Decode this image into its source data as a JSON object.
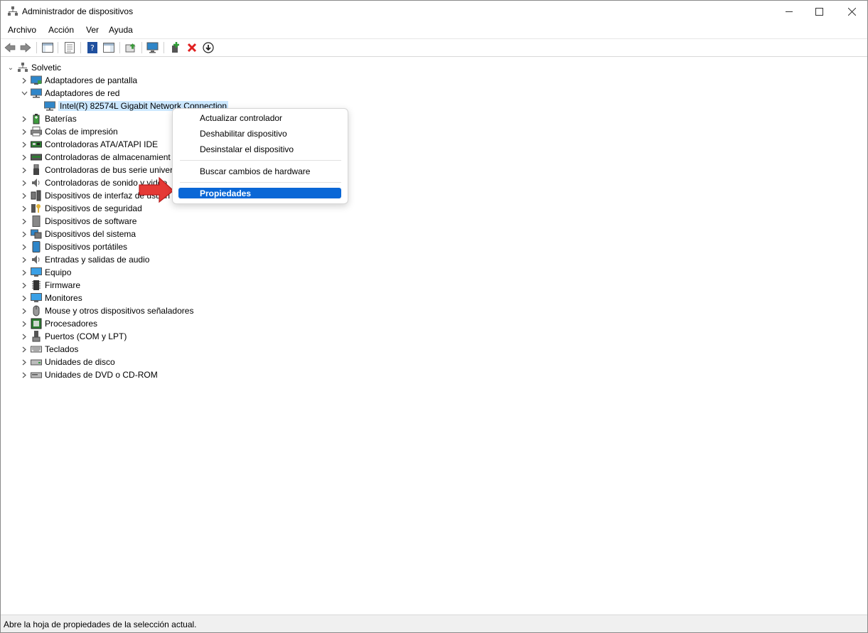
{
  "window": {
    "title": "Administrador de dispositivos"
  },
  "menubar": {
    "items": [
      "Archivo",
      "Acción",
      "Ver",
      "Ayuda"
    ]
  },
  "tree": {
    "root": "Solvetic",
    "items": [
      {
        "label": "Adaptadores de pantalla",
        "icon": "display-adapter-icon",
        "expanded": false
      },
      {
        "label": "Adaptadores de red",
        "icon": "network-adapter-icon",
        "expanded": true
      },
      {
        "label": "Intel(R) 82574L Gigabit Network Connection",
        "icon": "network-card-icon",
        "child": true,
        "selected": true
      },
      {
        "label": "Baterías",
        "icon": "battery-icon",
        "expanded": false
      },
      {
        "label": "Colas de impresión",
        "icon": "printer-icon",
        "expanded": false
      },
      {
        "label": "Controladoras ATA/ATAPI IDE",
        "icon": "ide-controller-icon",
        "expanded": false
      },
      {
        "label": "Controladoras de almacenamient",
        "icon": "storage-controller-icon",
        "expanded": false
      },
      {
        "label": "Controladoras de bus serie univer",
        "icon": "usb-icon",
        "expanded": false
      },
      {
        "label": "Controladoras de sonido y video",
        "icon": "speaker-icon",
        "expanded": false
      },
      {
        "label": "Dispositivos de interfaz de usuari",
        "icon": "hid-icon",
        "expanded": false
      },
      {
        "label": "Dispositivos de seguridad",
        "icon": "security-key-icon",
        "expanded": false
      },
      {
        "label": "Dispositivos de software",
        "icon": "software-device-icon",
        "expanded": false
      },
      {
        "label": "Dispositivos del sistema",
        "icon": "system-device-icon",
        "expanded": false
      },
      {
        "label": "Dispositivos portátiles",
        "icon": "portable-device-icon",
        "expanded": false
      },
      {
        "label": "Entradas y salidas de audio",
        "icon": "audio-io-icon",
        "expanded": false
      },
      {
        "label": "Equipo",
        "icon": "computer-icon",
        "expanded": false
      },
      {
        "label": "Firmware",
        "icon": "firmware-icon",
        "expanded": false
      },
      {
        "label": "Monitores",
        "icon": "monitor-icon",
        "expanded": false
      },
      {
        "label": "Mouse y otros dispositivos señaladores",
        "icon": "mouse-icon",
        "expanded": false
      },
      {
        "label": "Procesadores",
        "icon": "processor-icon",
        "expanded": false
      },
      {
        "label": "Puertos (COM y LPT)",
        "icon": "port-icon",
        "expanded": false
      },
      {
        "label": "Teclados",
        "icon": "keyboard-icon",
        "expanded": false
      },
      {
        "label": "Unidades de disco",
        "icon": "disk-drive-icon",
        "expanded": false
      },
      {
        "label": "Unidades de DVD o CD-ROM",
        "icon": "dvd-drive-icon",
        "expanded": false
      }
    ]
  },
  "context_menu": {
    "items": [
      "Actualizar controlador",
      "Deshabilitar dispositivo",
      "Desinstalar el dispositivo",
      "Buscar cambios de hardware",
      "Propiedades"
    ],
    "highlighted": "Propiedades"
  },
  "statusbar": {
    "text": "Abre la hoja de propiedades de la selección actual."
  },
  "colors": {
    "accent": "#0a67d6",
    "selection": "#cce8ff",
    "arrow": "#e53935"
  }
}
